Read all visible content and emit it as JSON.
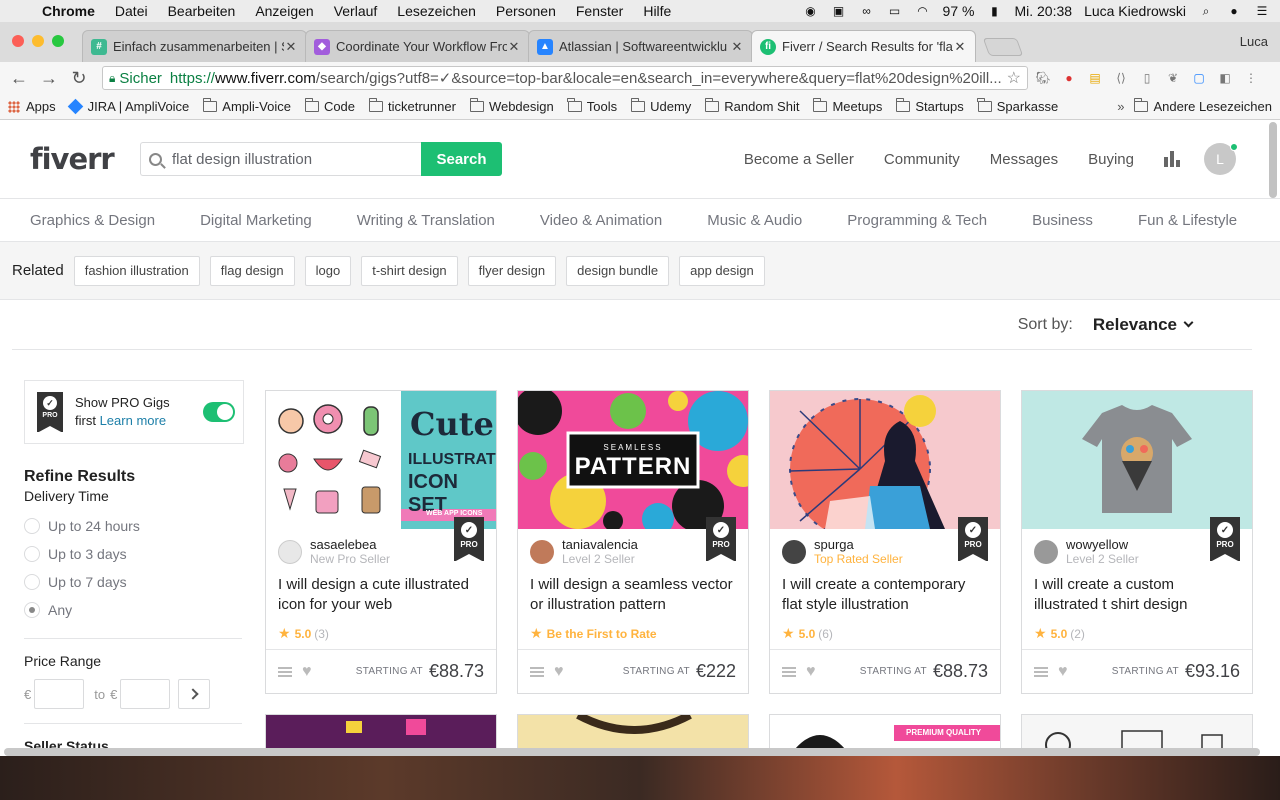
{
  "menubar": {
    "app": "Chrome",
    "items": [
      "Datei",
      "Bearbeiten",
      "Anzeigen",
      "Verlauf",
      "Lesezeichen",
      "Personen",
      "Fenster",
      "Hilfe"
    ],
    "battery": "97 %",
    "clock": "Mi. 20:38",
    "user": "Luca Kiedrowski"
  },
  "tabs": [
    {
      "title": "Einfach zusammenarbeiten | S",
      "favicon_color": "#3eb991",
      "favicon_glyph": "#",
      "active": false
    },
    {
      "title": "Coordinate Your Workflow Fro",
      "favicon_color": "#a25ddc",
      "favicon_glyph": "◆",
      "active": false
    },
    {
      "title": "Atlassian | Softwareentwicklu",
      "favicon_color": "#2684ff",
      "favicon_glyph": "▲",
      "active": false
    },
    {
      "title": "Fiverr / Search Results for 'flat",
      "favicon_color": "#1dbf73",
      "favicon_glyph": "fi",
      "active": true
    }
  ],
  "profile_name": "Luca",
  "omnibox": {
    "secure_label": "Sicher",
    "url_scheme": "https://",
    "url_host": "www.fiverr.com",
    "url_path": "/search/gigs?utf8=✓&source=top-bar&locale=en&search_in=everywhere&query=flat%20design%20ill..."
  },
  "bookmarks": [
    {
      "label": "Apps",
      "type": "apps"
    },
    {
      "label": "JIRA | AmpliVoice",
      "type": "jira"
    },
    {
      "label": "Ampli-Voice",
      "type": "folder"
    },
    {
      "label": "Code",
      "type": "folder"
    },
    {
      "label": "ticketrunner",
      "type": "folder"
    },
    {
      "label": "Webdesign",
      "type": "folder"
    },
    {
      "label": "Tools",
      "type": "folder"
    },
    {
      "label": "Udemy",
      "type": "folder"
    },
    {
      "label": "Random Shit",
      "type": "folder"
    },
    {
      "label": "Meetups",
      "type": "folder"
    },
    {
      "label": "Startups",
      "type": "folder"
    },
    {
      "label": "Sparkasse",
      "type": "folder"
    }
  ],
  "bookmarks_more": "»",
  "bookmarks_other": "Andere Lesezeichen",
  "header": {
    "logo": "fiverr",
    "search_value": "flat design illustration",
    "search_button": "Search",
    "nav": [
      "Become a Seller",
      "Community",
      "Messages",
      "Buying"
    ],
    "avatar_letter": "L"
  },
  "categories": [
    "Graphics & Design",
    "Digital Marketing",
    "Writing & Translation",
    "Video & Animation",
    "Music & Audio",
    "Programming & Tech",
    "Business",
    "Fun & Lifestyle"
  ],
  "related": {
    "label": "Related",
    "chips": [
      "fashion illustration",
      "flag design",
      "logo",
      "t-shirt design",
      "flyer design",
      "design bundle",
      "app design"
    ]
  },
  "sort": {
    "label": "Sort by:",
    "value": "Relevance"
  },
  "sidebar": {
    "pro_text": "Show PRO Gigs first",
    "pro_link": "Learn more",
    "pro_badge": "PRO",
    "refine_title": "Refine Results",
    "delivery_title": "Delivery Time",
    "delivery_options": [
      {
        "label": "Up to 24 hours",
        "selected": false
      },
      {
        "label": "Up to 3 days",
        "selected": false
      },
      {
        "label": "Up to 7 days",
        "selected": false
      },
      {
        "label": "Any",
        "selected": true
      }
    ],
    "price_title": "Price Range",
    "currency": "€",
    "to_label": "to",
    "seller_status_title": "Seller Status"
  },
  "gigs": [
    {
      "seller": "sasaelebea",
      "level": "New Pro Seller",
      "level_style": "normal",
      "title": "I will design a cute illustrated icon for your web",
      "rating": "5.0",
      "count": "(3)",
      "starting": "STARTING AT",
      "price": "€88.73",
      "avatar_color": "#e8e8e8",
      "thumb_text1": "Cute",
      "thumb_text2": "ILLUSTRATED",
      "thumb_text3": "ICON SET",
      "thumb_text4": "WEB APP ICONS"
    },
    {
      "seller": "taniavalencia",
      "level": "Level 2 Seller",
      "level_style": "normal",
      "title": "I will design a seamless vector or illustration pattern",
      "rating": "",
      "count": "",
      "first_rate": "Be the First to Rate",
      "starting": "STARTING AT",
      "price": "€222",
      "avatar_color": "#c07a5a",
      "thumb_text1": "SEAMLESS",
      "thumb_text2": "PATTERN"
    },
    {
      "seller": "spurga",
      "level": "Top Rated Seller",
      "level_style": "top",
      "title": "I will create a contemporary flat style illustration",
      "rating": "5.0",
      "count": "(6)",
      "starting": "STARTING AT",
      "price": "€88.73",
      "avatar_color": "#444"
    },
    {
      "seller": "wowyellow",
      "level": "Level 2 Seller",
      "level_style": "normal",
      "title": "I will create a custom illustrated t shirt design",
      "rating": "5.0",
      "count": "(2)",
      "starting": "STARTING AT",
      "price": "€93.16",
      "avatar_color": "#999"
    }
  ],
  "second_row_banner": "PREMIUM QUALITY"
}
